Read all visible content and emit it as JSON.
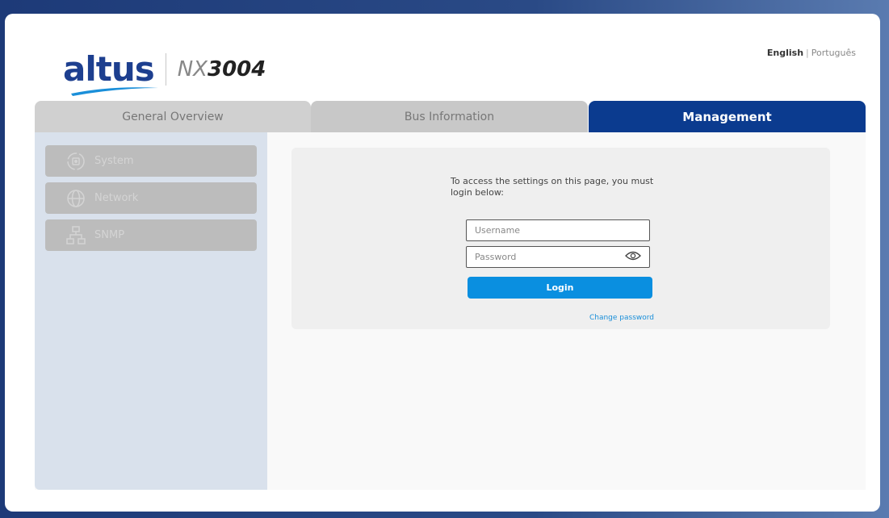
{
  "header": {
    "logo_text": "altus",
    "model_prefix": "NX",
    "model_number": "3004",
    "language": {
      "active": "English",
      "separator": "|",
      "other": "Português"
    }
  },
  "tabs": [
    {
      "label": "General Overview",
      "active": false
    },
    {
      "label": "Bus Information",
      "active": false
    },
    {
      "label": "Management",
      "active": true
    }
  ],
  "sidebar": {
    "items": [
      {
        "label": "System",
        "icon": "gear-refresh-icon"
      },
      {
        "label": "Network",
        "icon": "globe-icon"
      },
      {
        "label": "SNMP",
        "icon": "network-tree-icon"
      }
    ]
  },
  "login": {
    "message": "To access the settings on this page, you must login below:",
    "username_placeholder": "Username",
    "password_placeholder": "Password",
    "login_label": "Login",
    "change_password_label": "Change password"
  },
  "colors": {
    "brand": "#0b3b8f",
    "button": "#0a8fe0",
    "link": "#1a8fd9",
    "sidebar_bg": "#d9e1ec"
  }
}
